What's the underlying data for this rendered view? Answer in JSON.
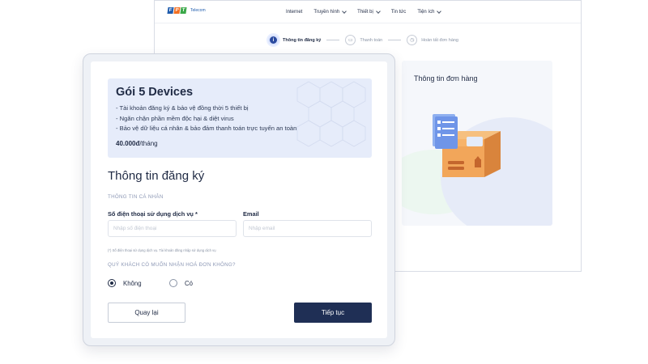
{
  "brand": {
    "logo_letters": [
      "F",
      "P",
      "T"
    ],
    "logo_text": "Telecom",
    "colors": {
      "blue": "#1f5cad",
      "orange": "#f27023",
      "green": "#3ba849",
      "navy": "#1f2f55"
    }
  },
  "nav": {
    "items": [
      {
        "label": "Internet",
        "has_dropdown": false
      },
      {
        "label": "Truyền hình",
        "has_dropdown": true
      },
      {
        "label": "Thiết bị",
        "has_dropdown": true
      },
      {
        "label": "Tin tức",
        "has_dropdown": false
      },
      {
        "label": "Tiện ích",
        "has_dropdown": true
      }
    ]
  },
  "stepper": {
    "steps": [
      {
        "label": "Thông tin đăng ký",
        "icon": "info-icon",
        "active": true
      },
      {
        "label": "Thanh toán",
        "icon": "card-icon",
        "active": false
      },
      {
        "label": "Hoàn tất đơn hàng",
        "icon": "clock-icon",
        "active": false
      }
    ]
  },
  "order": {
    "title": "Thông tin đơn hàng",
    "illustration": "package-box-icon"
  },
  "plan": {
    "name": "Gói 5 Devices",
    "features": [
      "- Tài khoản đăng ký & bảo vệ đồng thời 5 thiết bị",
      "- Ngăn chặn phần mềm độc hại & diệt virus",
      "- Bảo vệ dữ liệu cá nhân & bảo đảm thanh toán trực tuyến an toàn"
    ],
    "price": "40.000đ",
    "price_unit": "/tháng"
  },
  "form": {
    "title": "Thông tin đăng ký",
    "personal_section": "THÔNG TIN CÁ NHÂN",
    "phone": {
      "label": "Số điện thoại sử dụng dịch vụ *",
      "placeholder": "Nhập số điện thoại",
      "value": ""
    },
    "email": {
      "label": "Email",
      "placeholder": "Nhập email",
      "value": ""
    },
    "hint": "(*) Số điện thoại sử dụng dịch vụ. Tài khoản đăng nhập sử dụng dịch vụ",
    "invoice_question": "QUÝ KHÁCH CÓ MUỐN NHẬN HOÁ ĐƠN KHÔNG?",
    "invoice_options": [
      {
        "label": "Không",
        "selected": true
      },
      {
        "label": "Có",
        "selected": false
      }
    ]
  },
  "actions": {
    "back_label": "Quay lại",
    "next_label": "Tiếp tục"
  }
}
